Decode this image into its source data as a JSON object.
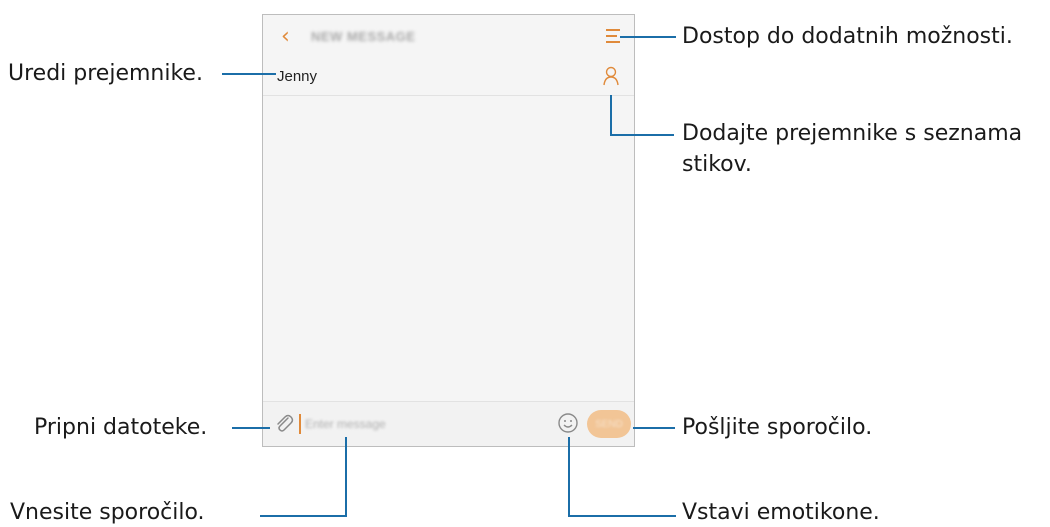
{
  "screen": {
    "title": "NEW MESSAGE",
    "recipient": "Jenny",
    "composer": {
      "placeholder": "Enter message",
      "send_label": "SEND"
    }
  },
  "callouts": {
    "more_options": "Dostop do dodatnih možnosti.",
    "edit_recipients": "Uredi prejemnike.",
    "add_from_contacts_line1": "Dodajte prejemnike s seznama",
    "add_from_contacts_line2": "stikov.",
    "attach_files": "Pripni datoteke.",
    "send_message": "Pošljite sporočilo.",
    "enter_message": "Vnesite sporočilo.",
    "insert_emoticons": "Vstavi emotikone."
  },
  "colors": {
    "accent": "#e08a3a",
    "callout_line": "#1b6ea8",
    "send_button": "#f2c596"
  },
  "icons": [
    "back-arrow-icon",
    "menu-icon",
    "contact-icon",
    "paperclip-icon",
    "smiley-icon"
  ]
}
